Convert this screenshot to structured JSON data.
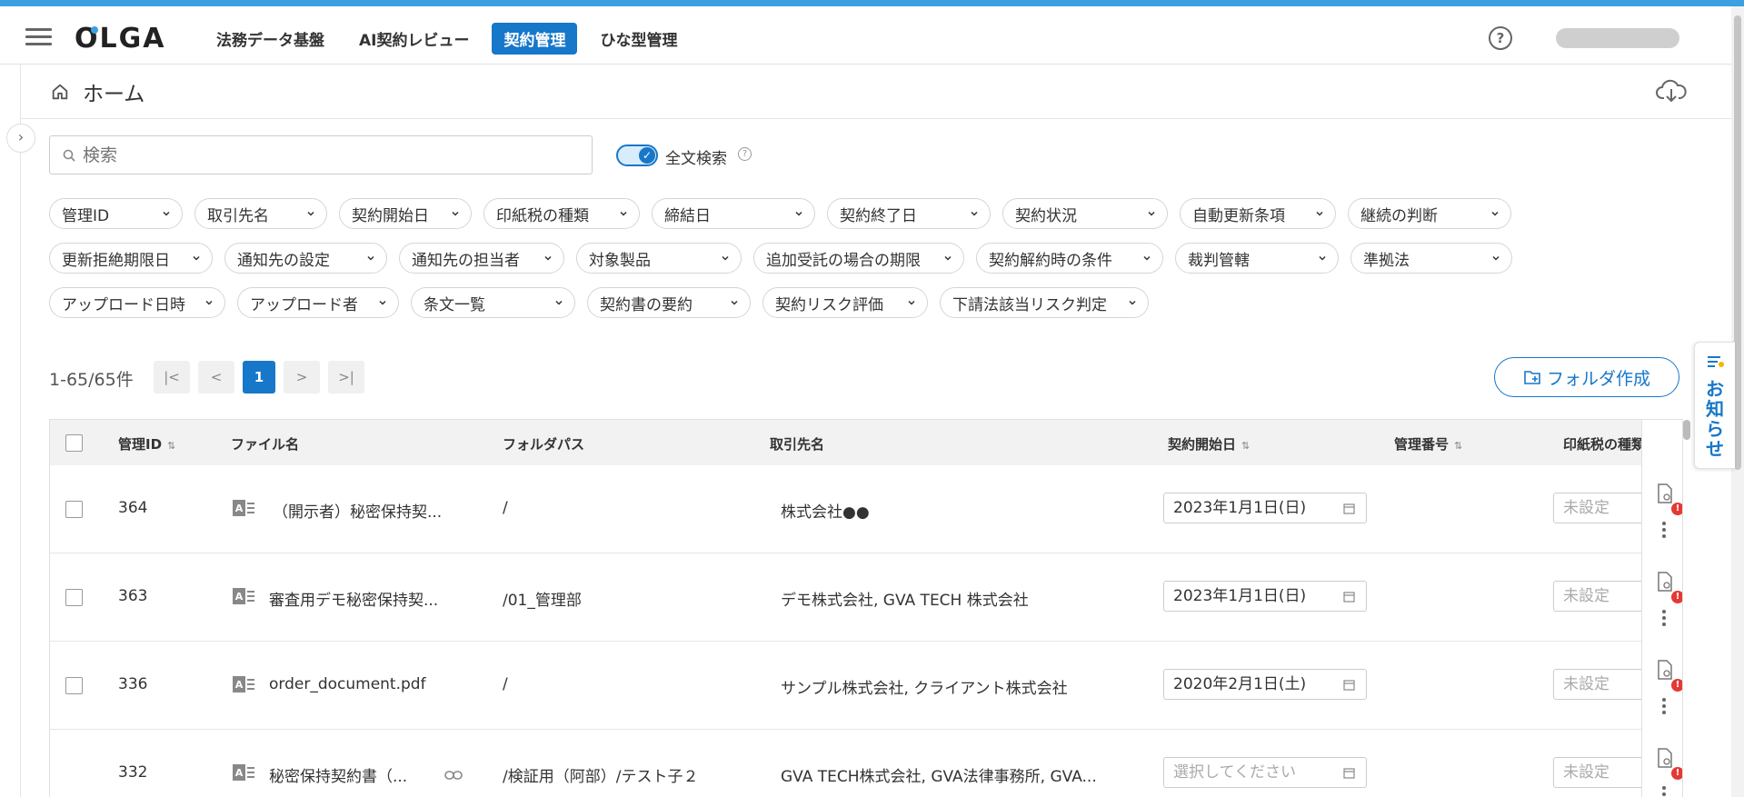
{
  "header": {
    "logo": "OLGA",
    "nav": [
      "法務データ基盤",
      "AI契約レビュー",
      "契約管理",
      "ひな型管理"
    ],
    "active_nav": "契約管理",
    "help": "?"
  },
  "breadcrumb": {
    "title": "ホーム"
  },
  "search": {
    "placeholder": "検索"
  },
  "fulltext": {
    "label": "全文検索",
    "enabled": true,
    "info": "?"
  },
  "filters": {
    "row1": [
      "管理ID",
      "取引先名",
      "契約開始日",
      "印紙税の種類",
      "締結日",
      "契約終了日",
      "契約状況",
      "自動更新条項",
      "継続の判断"
    ],
    "row2": [
      "更新拒絶期限日",
      "通知先の設定",
      "通知先の担当者",
      "対象製品",
      "追加受託の場合の期限",
      "契約解約時の条件",
      "裁判管轄",
      "準拠法"
    ],
    "row3": [
      "アップロード日時",
      "アップロード者",
      "条文一覧",
      "契約書の要約",
      "契約リスク評価",
      "下請法該当リスク判定"
    ]
  },
  "pagination": {
    "count": "1-65/65件",
    "first": "|<",
    "prev": "<",
    "page": "1",
    "next": ">",
    "last": ">|"
  },
  "folder_button": {
    "label": "フォルダ作成"
  },
  "news_tab": {
    "label": "お知らせ"
  },
  "table": {
    "headers": {
      "id": "管理ID",
      "file": "ファイル名",
      "folder": "フォルダパス",
      "partner": "取引先名",
      "start": "契約開始日",
      "number": "管理番号",
      "stamp": "印紙税の種類"
    },
    "rows": [
      {
        "id": "364",
        "file": "（開示者）秘密保持契...",
        "folder": "/",
        "partner": "株式会社●●",
        "start": "2023年1月1日(日)",
        "start_empty": false,
        "stamp": "未設定"
      },
      {
        "id": "363",
        "file": "審査用デモ秘密保持契...",
        "folder": "/01_管理部",
        "partner": "デモ株式会社, GVA TECH 株式会社",
        "start": "2023年1月1日(日)",
        "start_empty": false,
        "stamp": "未設定"
      },
      {
        "id": "336",
        "file": "order_document.pdf",
        "folder": "/",
        "partner": "サンプル株式会社, クライアント株式会社",
        "start": "2020年2月1日(土)",
        "start_empty": false,
        "stamp": "未設定"
      },
      {
        "id": "332",
        "file": "秘密保持契約書（...",
        "folder": "/検証用（阿部）/テスト子２",
        "partner": "GVA TECH株式会社, GVA法律事務所, GVA...",
        "start": "選択してください",
        "start_empty": true,
        "stamp": "未設定"
      }
    ],
    "alert": "!"
  },
  "colors": {
    "accent": "#1777c9",
    "topbar": "#3b9fe0",
    "alert": "#e53935"
  }
}
